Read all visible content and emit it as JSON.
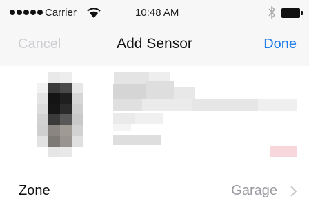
{
  "status_bar": {
    "carrier": "Carrier",
    "time": "10:48 AM",
    "icons": [
      "signal-dots-icon",
      "wifi-icon",
      "bluetooth-icon",
      "battery-icon"
    ]
  },
  "nav": {
    "cancel_label": "Cancel",
    "title": "Add Sensor",
    "done_label": "Done"
  },
  "sensor": {
    "image": "sensor-device-image"
  },
  "zone": {
    "label": "Zone",
    "value": "Garage"
  },
  "colors": {
    "accent": "#1f7bea",
    "disabled": "#cfcfd3",
    "secondary_text": "#9a9aa0",
    "bar_background": "#f7f7f8"
  }
}
